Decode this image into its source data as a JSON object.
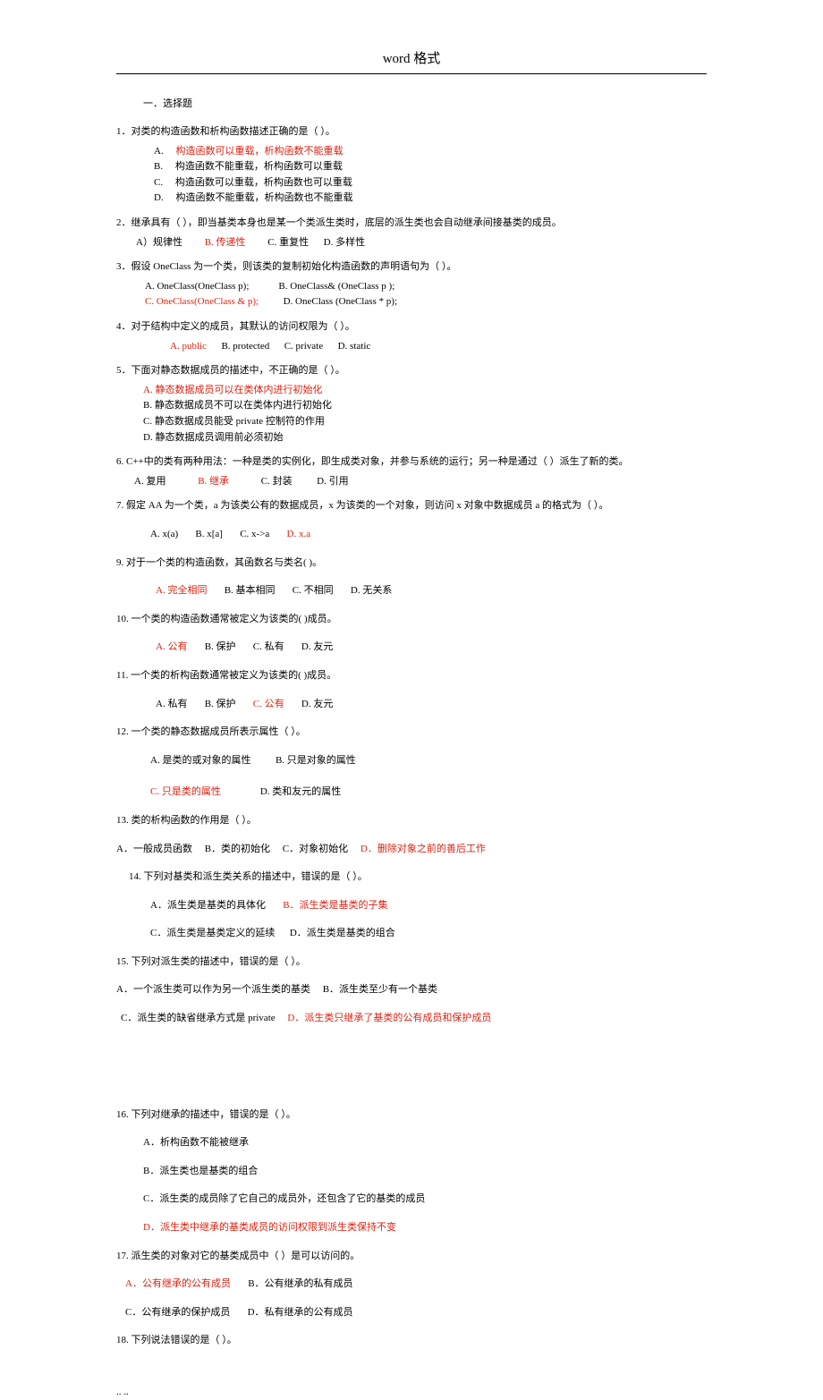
{
  "header": "word 格式",
  "section_title": "一．选择题",
  "q1": {
    "stem": "1．对类的构造函数和析构函数描述正确的是（  ）。",
    "a": "构造函数可以重载，析构函数不能重载",
    "b": "构造函数不能重载，析构函数可以重载",
    "c": "构造函数可以重载，析构函数也可以重载",
    "d": "构造函数不能重载，析构函数也不能重载"
  },
  "q2": {
    "stem_pre": "2．继承具有（     ），即当基类本身也是某一个类派生类时，底层的派生类也会自动继承间接基类的成员。",
    "a": "A）规律性",
    "b": "B. 传递性",
    "c": "C. 重复性",
    "d": "D. 多样性"
  },
  "q3": {
    "stem": "3．假设 OneClass 为一个类，则该类的复制初始化构造函数的声明语句为（   ）。",
    "a": "A. OneClass(OneClass  p);",
    "b": "B. OneClass& (OneClass p );",
    "c": "C. OneClass(OneClass  & p);",
    "d": "D. OneClass (OneClass  * p);"
  },
  "q4": {
    "stem": "4．对于结构中定义的成员，其默认的访问权限为（   ）。",
    "a": "A. public",
    "b": "B. protected",
    "c": "C. private",
    "d": "D. static"
  },
  "q5": {
    "stem": "5．下面对静态数据成员的描述中，不正确的是（   ）。",
    "a": "A. 静态数据成员可以在类体内进行初始化",
    "b": "B. 静态数据成员不可以在类体内进行初始化",
    "c": "C. 静态数据成员能受 private 控制符的作用",
    "d": "D. 静态数据成员调用前必须初始"
  },
  "q6": {
    "stem": "6. C++中的类有两种用法：一种是类的实例化，即生成类对象，并参与系统的运行；另一种是通过（    ）派生了新的类。",
    "a": "A. 复用",
    "b": "B. 继承",
    "c": "C. 封装",
    "d": "D. 引用"
  },
  "q7": {
    "stem": "7. 假定 AA 为一个类，a 为该类公有的数据成员，x 为该类的一个对象，则访问 x 对象中数据成员 a 的格式为（   ）。",
    "a": "A. x(a)",
    "b": "B. x[a]",
    "c": "C. x->a",
    "d": "D. x.a"
  },
  "q9": {
    "stem": "9.  对于一个类的构造函数，其函数名与类名(   )。",
    "a": "A. 完全相同",
    "b": "B. 基本相同",
    "c": "C. 不相同",
    "d": "D. 无关系"
  },
  "q10": {
    "stem": "10.  一个类的构造函数通常被定义为该类的(   )成员。",
    "a": "A. 公有",
    "b": "B. 保护",
    "c": "C. 私有",
    "d": "D. 友元"
  },
  "q11": {
    "stem": "11.  一个类的析构函数通常被定义为该类的(   )成员。",
    "a": "A. 私有",
    "b": "B. 保护",
    "c": "C. 公有",
    "d": "D. 友元"
  },
  "q12": {
    "stem": "12.  一个类的静态数据成员所表示属性（   ）。",
    "a": "A.  是类的或对象的属性",
    "b": "B.  只是对象的属性",
    "c": "C.  只是类的属性",
    "d": "D.  类和友元的属性"
  },
  "q13": {
    "stem": "13. 类的析构函数的作用是（   ）。",
    "a": "A．一般成员函数",
    "b": "B．类的初始化",
    "c": "C．对象初始化",
    "d": "D．删除对象之前的善后工作"
  },
  "q14": {
    "stem": "14. 下列对基类和派生类关系的描述中，错误的是（   ）。",
    "a": "A．派生类是基类的具体化",
    "b": "B．派生类是基类的子集",
    "c": "C．派生类是基类定义的延续",
    "d": "D．派生类是基类的组合"
  },
  "q15": {
    "stem": "15. 下列对派生类的描述中，错误的是（   ）。",
    "a": "A．一个派生类可以作为另一个派生类的基类",
    "b": "B．派生类至少有一个基类",
    "c": "C．派生类的缺省继承方式是 private",
    "d": "D．派生类只继承了基类的公有成员和保护成员"
  },
  "q16": {
    "stem": "16. 下列对继承的描述中，错误的是（   ）。",
    "a": "A．析构函数不能被继承",
    "b": "B．派生类也是基类的组合",
    "c": "C．派生类的成员除了它自己的成员外，还包含了它的基类的成员",
    "d": "D．派生类中继承的基类成员的访问权限到派生类保持不变"
  },
  "q17": {
    "stem": "17. 派生类的对象对它的基类成员中（    ）是可以访问的。",
    "a": "A．公有继承的公有成员",
    "b": "B．公有继承的私有成员",
    "c": "C．公有继承的保护成员",
    "d": "D．私有继承的公有成员"
  },
  "q18": {
    "stem": "18. 下列说法错误的是（    ）。"
  },
  "footer": ".. .."
}
